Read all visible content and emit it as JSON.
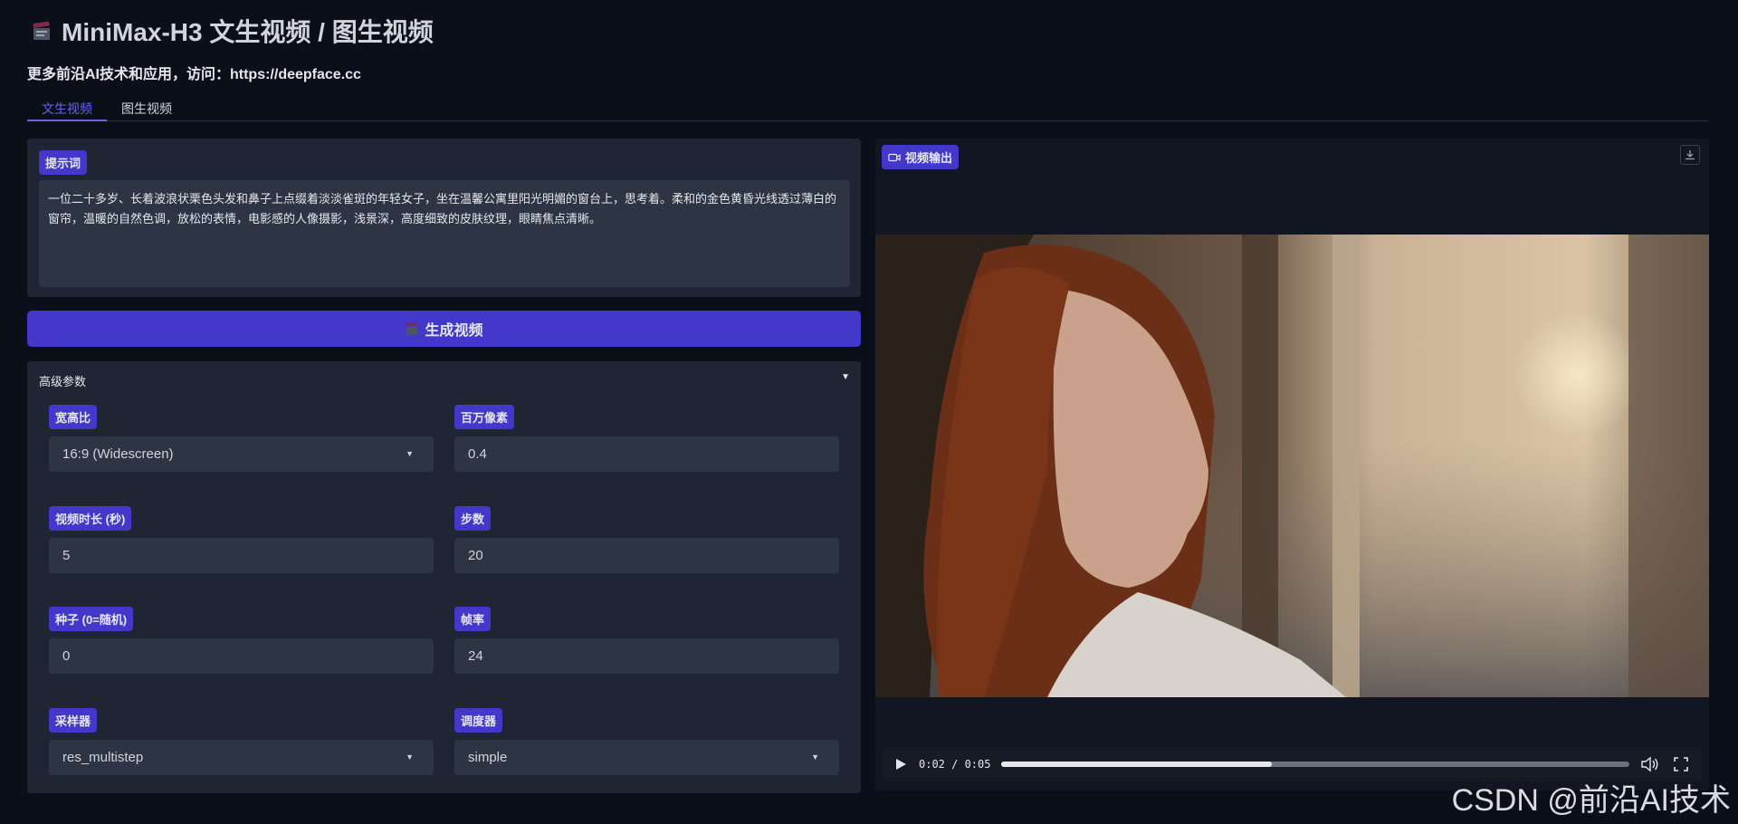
{
  "header": {
    "title": "MiniMax-H3 文生视频 / 图生视频",
    "subtitle": "更多前沿AI技术和应用，访问：https://deepface.cc"
  },
  "tabs": [
    {
      "label": "文生视频",
      "active": true
    },
    {
      "label": "图生视频",
      "active": false
    }
  ],
  "prompt": {
    "label": "提示词",
    "value": "一位二十多岁、长着波浪状栗色头发和鼻子上点缀着淡淡雀斑的年轻女子，坐在温馨公寓里阳光明媚的窗台上，思考着。柔和的金色黄昏光线透过薄白的窗帘，温暖的自然色调，放松的表情，电影感的人像摄影，浅景深，高度细致的皮肤纹理，眼睛焦点清晰。"
  },
  "generate_button": {
    "label": "生成视频"
  },
  "advanced": {
    "header": "高级参数",
    "fields": {
      "aspect": {
        "label": "宽高比",
        "value": "16:9 (Widescreen)"
      },
      "megapixels": {
        "label": "百万像素",
        "value": "0.4"
      },
      "duration": {
        "label": "视频时长 (秒)",
        "value": "5"
      },
      "steps": {
        "label": "步数",
        "value": "20"
      },
      "seed": {
        "label": "种子 (0=随机)",
        "value": "0"
      },
      "fps": {
        "label": "帧率",
        "value": "24"
      },
      "sampler": {
        "label": "采样器",
        "value": "res_multistep"
      },
      "scheduler": {
        "label": "调度器",
        "value": "simple"
      }
    }
  },
  "video": {
    "label": "视频输出",
    "time": "0:02 / 0:05",
    "progress_fraction": 0.43
  },
  "watermark": "CSDN @前沿AI技术",
  "colors": {
    "accent": "#4338ca",
    "background": "#0b0f19",
    "panel": "#1f2532"
  }
}
